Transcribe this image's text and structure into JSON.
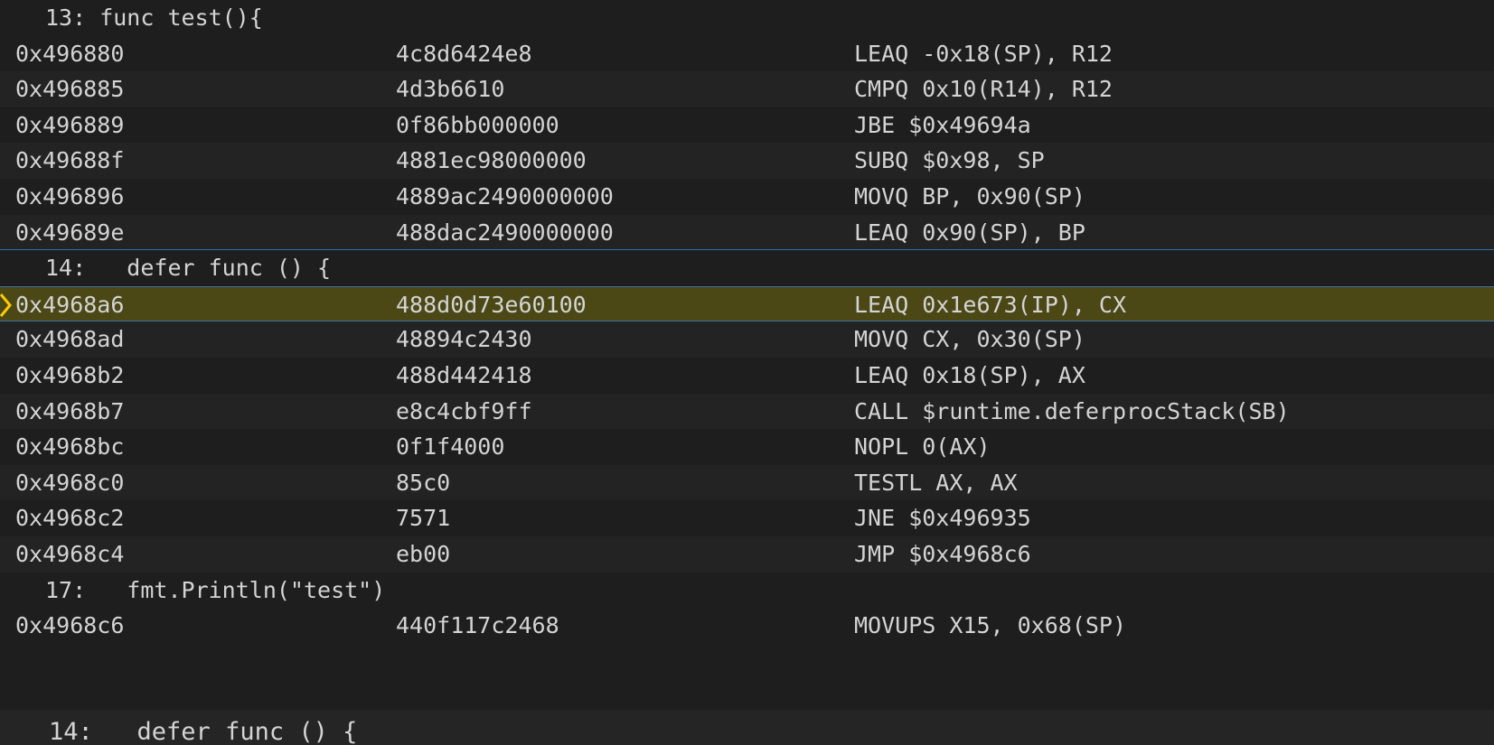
{
  "disassembly": {
    "rows": [
      {
        "type": "source",
        "text": "13: func test(){"
      },
      {
        "type": "instr",
        "address": "0x496880",
        "bytes": "4c8d6424e8",
        "instruction": "LEAQ -0x18(SP), R12"
      },
      {
        "type": "instr",
        "address": "0x496885",
        "bytes": "4d3b6610",
        "instruction": "CMPQ 0x10(R14), R12"
      },
      {
        "type": "instr",
        "address": "0x496889",
        "bytes": "0f86bb000000",
        "instruction": "JBE $0x49694a"
      },
      {
        "type": "instr",
        "address": "0x49688f",
        "bytes": "4881ec98000000",
        "instruction": "SUBQ $0x98, SP"
      },
      {
        "type": "instr",
        "address": "0x496896",
        "bytes": "4889ac2490000000",
        "instruction": "MOVQ BP, 0x90(SP)"
      },
      {
        "type": "instr",
        "address": "0x49689e",
        "bytes": "488dac2490000000",
        "instruction": "LEAQ 0x90(SP), BP"
      },
      {
        "type": "source",
        "text": "14:   defer func () {"
      },
      {
        "type": "instr",
        "address": "0x4968a6",
        "bytes": "488d0d73e60100",
        "instruction": "LEAQ 0x1e673(IP), CX",
        "current": true
      },
      {
        "type": "instr",
        "address": "0x4968ad",
        "bytes": "48894c2430",
        "instruction": "MOVQ CX, 0x30(SP)"
      },
      {
        "type": "instr",
        "address": "0x4968b2",
        "bytes": "488d442418",
        "instruction": "LEAQ 0x18(SP), AX"
      },
      {
        "type": "instr",
        "address": "0x4968b7",
        "bytes": "e8c4cbf9ff",
        "instruction": "CALL $runtime.deferprocStack(SB)"
      },
      {
        "type": "instr",
        "address": "0x4968bc",
        "bytes": "0f1f4000",
        "instruction": "NOPL 0(AX)"
      },
      {
        "type": "instr",
        "address": "0x4968c0",
        "bytes": "85c0",
        "instruction": "TESTL AX, AX"
      },
      {
        "type": "instr",
        "address": "0x4968c2",
        "bytes": "7571",
        "instruction": "JNE $0x496935"
      },
      {
        "type": "instr",
        "address": "0x4968c4",
        "bytes": "eb00",
        "instruction": "JMP $0x4968c6"
      },
      {
        "type": "source",
        "text": "17:   fmt.Println(\"test\")"
      },
      {
        "type": "instr",
        "address": "0x4968c6",
        "bytes": "440f117c2468",
        "instruction": "MOVUPS X15, 0x68(SP)"
      }
    ]
  },
  "peek": {
    "text": "14:   defer func () {"
  },
  "colors": {
    "background": "#1e1e1e",
    "alt_row": "#232323",
    "current_line": "#4b4816",
    "current_arrow": "#ffcc00",
    "text": "#d4d4d4",
    "separator": "#2f6ea8"
  },
  "icons": {
    "current_instruction": "debug-stackframe-arrow-icon"
  }
}
